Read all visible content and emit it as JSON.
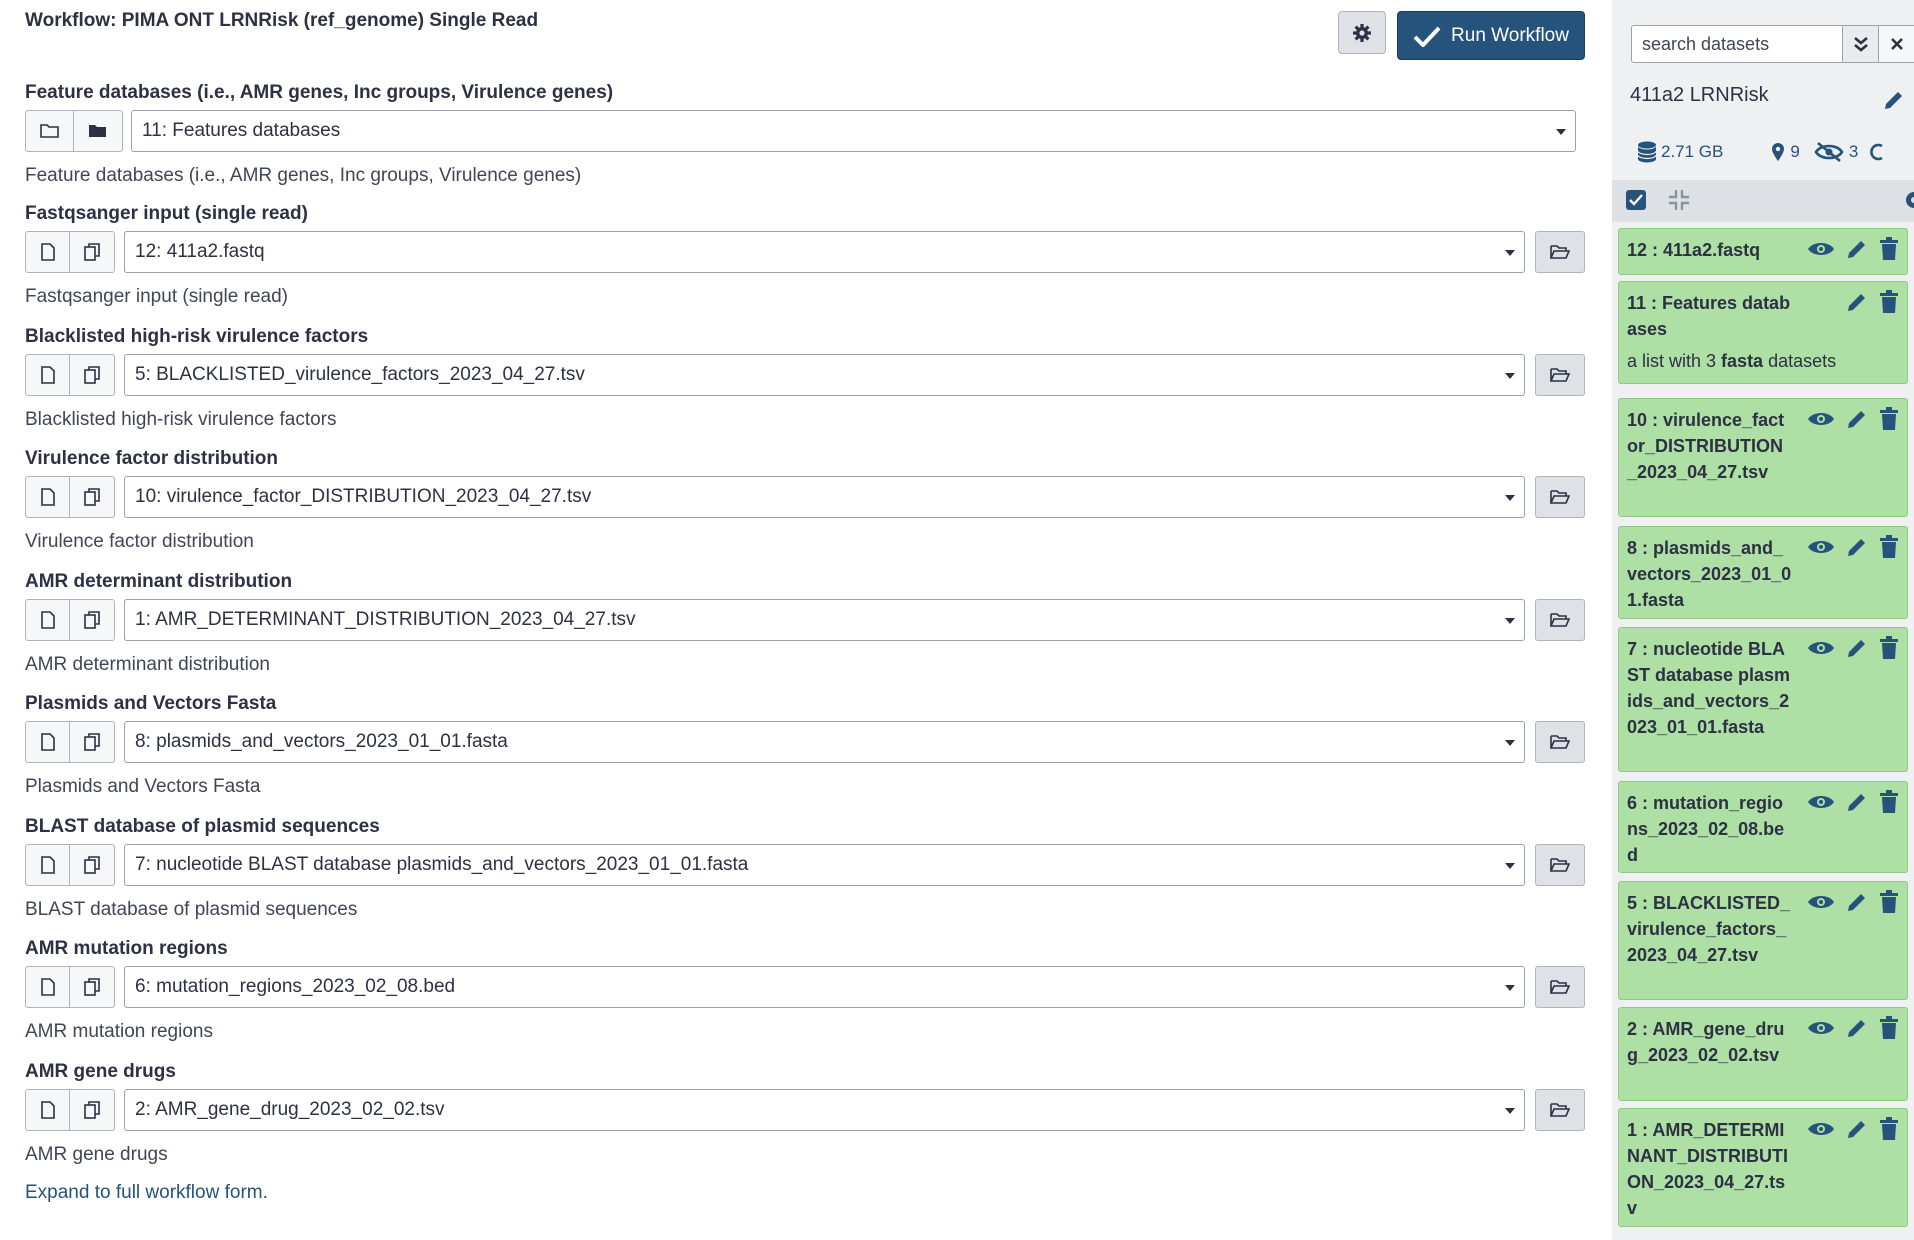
{
  "workflow": {
    "title": "Workflow: PIMA ONT LRNRisk (ref_genome) Single Read",
    "run_label": "Run Workflow",
    "expand_link": "Expand to full workflow form."
  },
  "inputs": [
    {
      "label": "Feature databases (i.e., AMR genes, Inc groups, Virulence genes)",
      "value": "11: Features databases",
      "help": "Feature databases (i.e., AMR genes, Inc groups, Virulence genes)"
    },
    {
      "label": "Fastqsanger input (single read)",
      "value": "12: 411a2.fastq",
      "help": "Fastqsanger input (single read)"
    },
    {
      "label": "Blacklisted high-risk virulence factors",
      "value": "5: BLACKLISTED_virulence_factors_2023_04_27.tsv",
      "help": "Blacklisted high-risk virulence factors"
    },
    {
      "label": "Virulence factor distribution",
      "value": "10: virulence_factor_DISTRIBUTION_2023_04_27.tsv",
      "help": "Virulence factor distribution"
    },
    {
      "label": "AMR determinant distribution",
      "value": "1: AMR_DETERMINANT_DISTRIBUTION_2023_04_27.tsv",
      "help": "AMR determinant distribution"
    },
    {
      "label": "Plasmids and Vectors Fasta",
      "value": "8: plasmids_and_vectors_2023_01_01.fasta",
      "help": "Plasmids and Vectors Fasta"
    },
    {
      "label": "BLAST database of plasmid sequences",
      "value": "7: nucleotide BLAST database plasmids_and_vectors_2023_01_01.fasta",
      "help": "BLAST database of plasmid sequences"
    },
    {
      "label": "AMR mutation regions",
      "value": "6: mutation_regions_2023_02_08.bed",
      "help": "AMR mutation regions"
    },
    {
      "label": "AMR gene drugs",
      "value": "2: AMR_gene_drug_2023_02_02.tsv",
      "help": "AMR gene drugs"
    }
  ],
  "history": {
    "search_placeholder": "search datasets",
    "name": "411a2 LRNRisk",
    "size": "2.71 GB",
    "shown_count": "9",
    "hidden_count": "3",
    "items": [
      {
        "title": "12 : 411a2.fastq"
      },
      {
        "title": "11 : Features databases",
        "subtitle_pre": "a list with 3 ",
        "subtitle_bold": "fasta",
        "subtitle_post": " datasets"
      },
      {
        "title": "10 : virulence_factor_DISTRIBUTION_2023_04_27.tsv"
      },
      {
        "title": "8 : plasmids_and_vectors_2023_01_01.fasta"
      },
      {
        "title": "7 : nucleotide BLAST database plasmids_and_vectors_2023_01_01.fasta"
      },
      {
        "title": "6 : mutation_regions_2023_02_08.bed"
      },
      {
        "title": "5 : BLACKLISTED_virulence_factors_2023_04_27.tsv"
      },
      {
        "title": "2 : AMR_gene_drug_2023_02_02.tsv"
      },
      {
        "title": "1 : AMR_DETERMINANT_DISTRIBUTION_2023_04_27.tsv"
      }
    ]
  },
  "colors": {
    "primary": "#25537b",
    "dataset_ok_bg": "#aedfa4",
    "panel_bg": "#eef0f2"
  }
}
